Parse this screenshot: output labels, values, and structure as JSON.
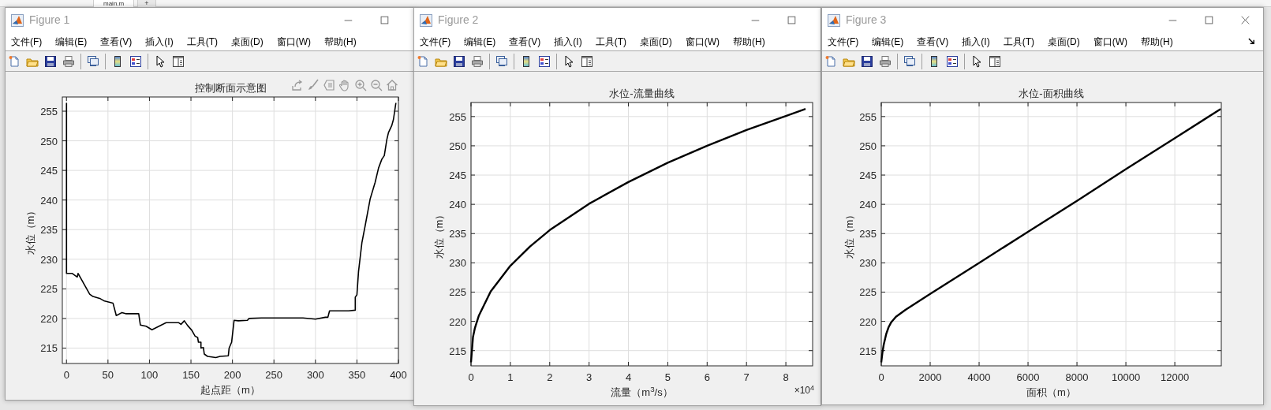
{
  "editor_tab": {
    "label": "main.m",
    "add_label": "+"
  },
  "figures": [
    {
      "title": "Figure 1",
      "window_controls": [
        {
          "kind": "minimize"
        },
        {
          "kind": "maximize"
        }
      ],
      "menu": [
        "文件(F)",
        "编辑(E)",
        "查看(V)",
        "插入(I)",
        "工具(T)",
        "桌面(D)",
        "窗口(W)",
        "帮助(H)"
      ],
      "menu_overflow": false,
      "toolbar": [
        {
          "kind": "new"
        },
        {
          "kind": "open"
        },
        {
          "kind": "save"
        },
        {
          "kind": "print"
        },
        {
          "kind": "separator"
        },
        {
          "kind": "link"
        },
        {
          "kind": "separator"
        },
        {
          "kind": "colorbar"
        },
        {
          "kind": "legend"
        },
        {
          "kind": "separator"
        },
        {
          "kind": "pointer"
        },
        {
          "kind": "inspector"
        }
      ],
      "axes_toolbar": [
        {
          "kind": "export"
        },
        {
          "kind": "brush"
        },
        {
          "kind": "datatip"
        },
        {
          "kind": "pan"
        },
        {
          "kind": "zoom_in"
        },
        {
          "kind": "zoom_out"
        },
        {
          "kind": "home"
        }
      ],
      "chart_data": {
        "type": "line",
        "title": "控制断面示意图",
        "xlabel": "起点距（m）",
        "ylabel": "水位（m）",
        "x": [
          0,
          0,
          7,
          13,
          14,
          28,
          32,
          40,
          45,
          56,
          60,
          67,
          72,
          87,
          89,
          96,
          103,
          120,
          135,
          138,
          142,
          146,
          151,
          155,
          158,
          159,
          162,
          162,
          165,
          166,
          168,
          170,
          180,
          185,
          195,
          196,
          199,
          202,
          207,
          218,
          220,
          235,
          250,
          270,
          285,
          300,
          312,
          315,
          317,
          323,
          340,
          348,
          348,
          350,
          352,
          356,
          360,
          366,
          372,
          376,
          380,
          383,
          386,
          388,
          392,
          394,
          397
        ],
        "series": [
          {
            "color": "#000000",
            "values": [
              256.4,
              227.6,
              227.6,
              227,
              227.6,
              224.1,
              223.7,
              223.4,
              223,
              222.6,
              220.5,
              221,
              220.8,
              220.8,
              218.9,
              218.7,
              218.1,
              219.3,
              219.3,
              219,
              219.6,
              218.8,
              218,
              217,
              216.8,
              216,
              216,
              215,
              215.1,
              214,
              213.8,
              213.6,
              213.4,
              213.6,
              213.7,
              215,
              216,
              219.7,
              219.6,
              219.7,
              220,
              220.1,
              220.1,
              220.1,
              220.1,
              219.9,
              220.2,
              220.2,
              221.3,
              221.3,
              221.3,
              221.4,
              223.6,
              224,
              228,
              232.8,
              235.7,
              240.2,
              243,
              245.4,
              246.9,
              247.5,
              250.2,
              251.4,
              252.6,
              253.6,
              256.4
            ]
          }
        ],
        "grid": true,
        "xlim": [
          -5,
          400
        ],
        "ylim": [
          212.4,
          257.4
        ],
        "xticks": [
          0,
          50,
          100,
          150,
          200,
          250,
          300,
          350,
          400
        ],
        "yticks": [
          215,
          220,
          225,
          230,
          235,
          240,
          245,
          250,
          255
        ]
      }
    },
    {
      "title": "Figure 2",
      "window_controls": [
        {
          "kind": "minimize"
        },
        {
          "kind": "maximize"
        }
      ],
      "menu": [
        "文件(F)",
        "编辑(E)",
        "查看(V)",
        "插入(I)",
        "工具(T)",
        "桌面(D)",
        "窗口(W)",
        "帮助(H)"
      ],
      "menu_overflow": false,
      "toolbar": [
        {
          "kind": "new"
        },
        {
          "kind": "open"
        },
        {
          "kind": "save"
        },
        {
          "kind": "print"
        },
        {
          "kind": "separator"
        },
        {
          "kind": "link"
        },
        {
          "kind": "separator"
        },
        {
          "kind": "colorbar"
        },
        {
          "kind": "legend"
        },
        {
          "kind": "separator"
        },
        {
          "kind": "pointer"
        },
        {
          "kind": "inspector"
        }
      ],
      "chart_data": {
        "type": "line",
        "title": "水位-流量曲线",
        "xlabel": "流量（m$^{3}$/s）",
        "ylabel": "水位（m）",
        "x": [
          0,
          0.05,
          0.1,
          0.2,
          0.5,
          1,
          1.5,
          2,
          3,
          4,
          5,
          6,
          7,
          8,
          8.5
        ],
        "series": [
          {
            "color": "#000000",
            "values": [
              213,
              217.3,
              218.9,
              221,
              225.1,
              229.5,
              232.8,
              235.6,
              240.1,
              243.8,
              247.1,
              250,
              252.7,
              255.1,
              256.3
            ]
          }
        ],
        "grid": true,
        "xlim": [
          0,
          8.68
        ],
        "ylim": [
          212.4,
          257.4
        ],
        "xticks": [
          0,
          1,
          2,
          3,
          4,
          5,
          6,
          7,
          8
        ],
        "yticks": [
          215,
          220,
          225,
          230,
          235,
          240,
          245,
          250,
          255
        ]
      },
      "x_axis_exponent": "×10$^{4}$"
    },
    {
      "title": "Figure 3",
      "window_controls": [
        {
          "kind": "minimize"
        },
        {
          "kind": "maximize"
        },
        {
          "kind": "close"
        }
      ],
      "menu": [
        "文件(F)",
        "编辑(E)",
        "查看(V)",
        "插入(I)",
        "工具(T)",
        "桌面(D)",
        "窗口(W)",
        "帮助(H)"
      ],
      "menu_overflow": true,
      "toolbar": [
        {
          "kind": "new"
        },
        {
          "kind": "open"
        },
        {
          "kind": "save"
        },
        {
          "kind": "print"
        },
        {
          "kind": "separator"
        },
        {
          "kind": "link"
        },
        {
          "kind": "separator"
        },
        {
          "kind": "colorbar"
        },
        {
          "kind": "legend"
        },
        {
          "kind": "separator"
        },
        {
          "kind": "pointer"
        },
        {
          "kind": "inspector"
        }
      ],
      "chart_data": {
        "type": "line",
        "title": "水位-面积曲线",
        "xlabel": "面积（m）",
        "ylabel": "水位（m）",
        "x": [
          0,
          50,
          100,
          200,
          300,
          400,
          600,
          1000,
          2000,
          4000,
          6000,
          8000,
          10000,
          12000,
          13875
        ],
        "series": [
          {
            "color": "#000000",
            "values": [
              213,
              214.8,
              216,
              217.8,
              219,
              219.8,
              220.8,
              222,
              224.7,
              230,
              235.3,
              240.6,
              246,
              251.3,
              256.3
            ]
          }
        ],
        "grid": true,
        "xlim": [
          0,
          13900
        ],
        "ylim": [
          212.4,
          257.4
        ],
        "xticks": [
          0,
          2000,
          4000,
          6000,
          8000,
          10000,
          12000
        ],
        "yticks": [
          215,
          220,
          225,
          230,
          235,
          240,
          245,
          250,
          255
        ]
      }
    }
  ]
}
